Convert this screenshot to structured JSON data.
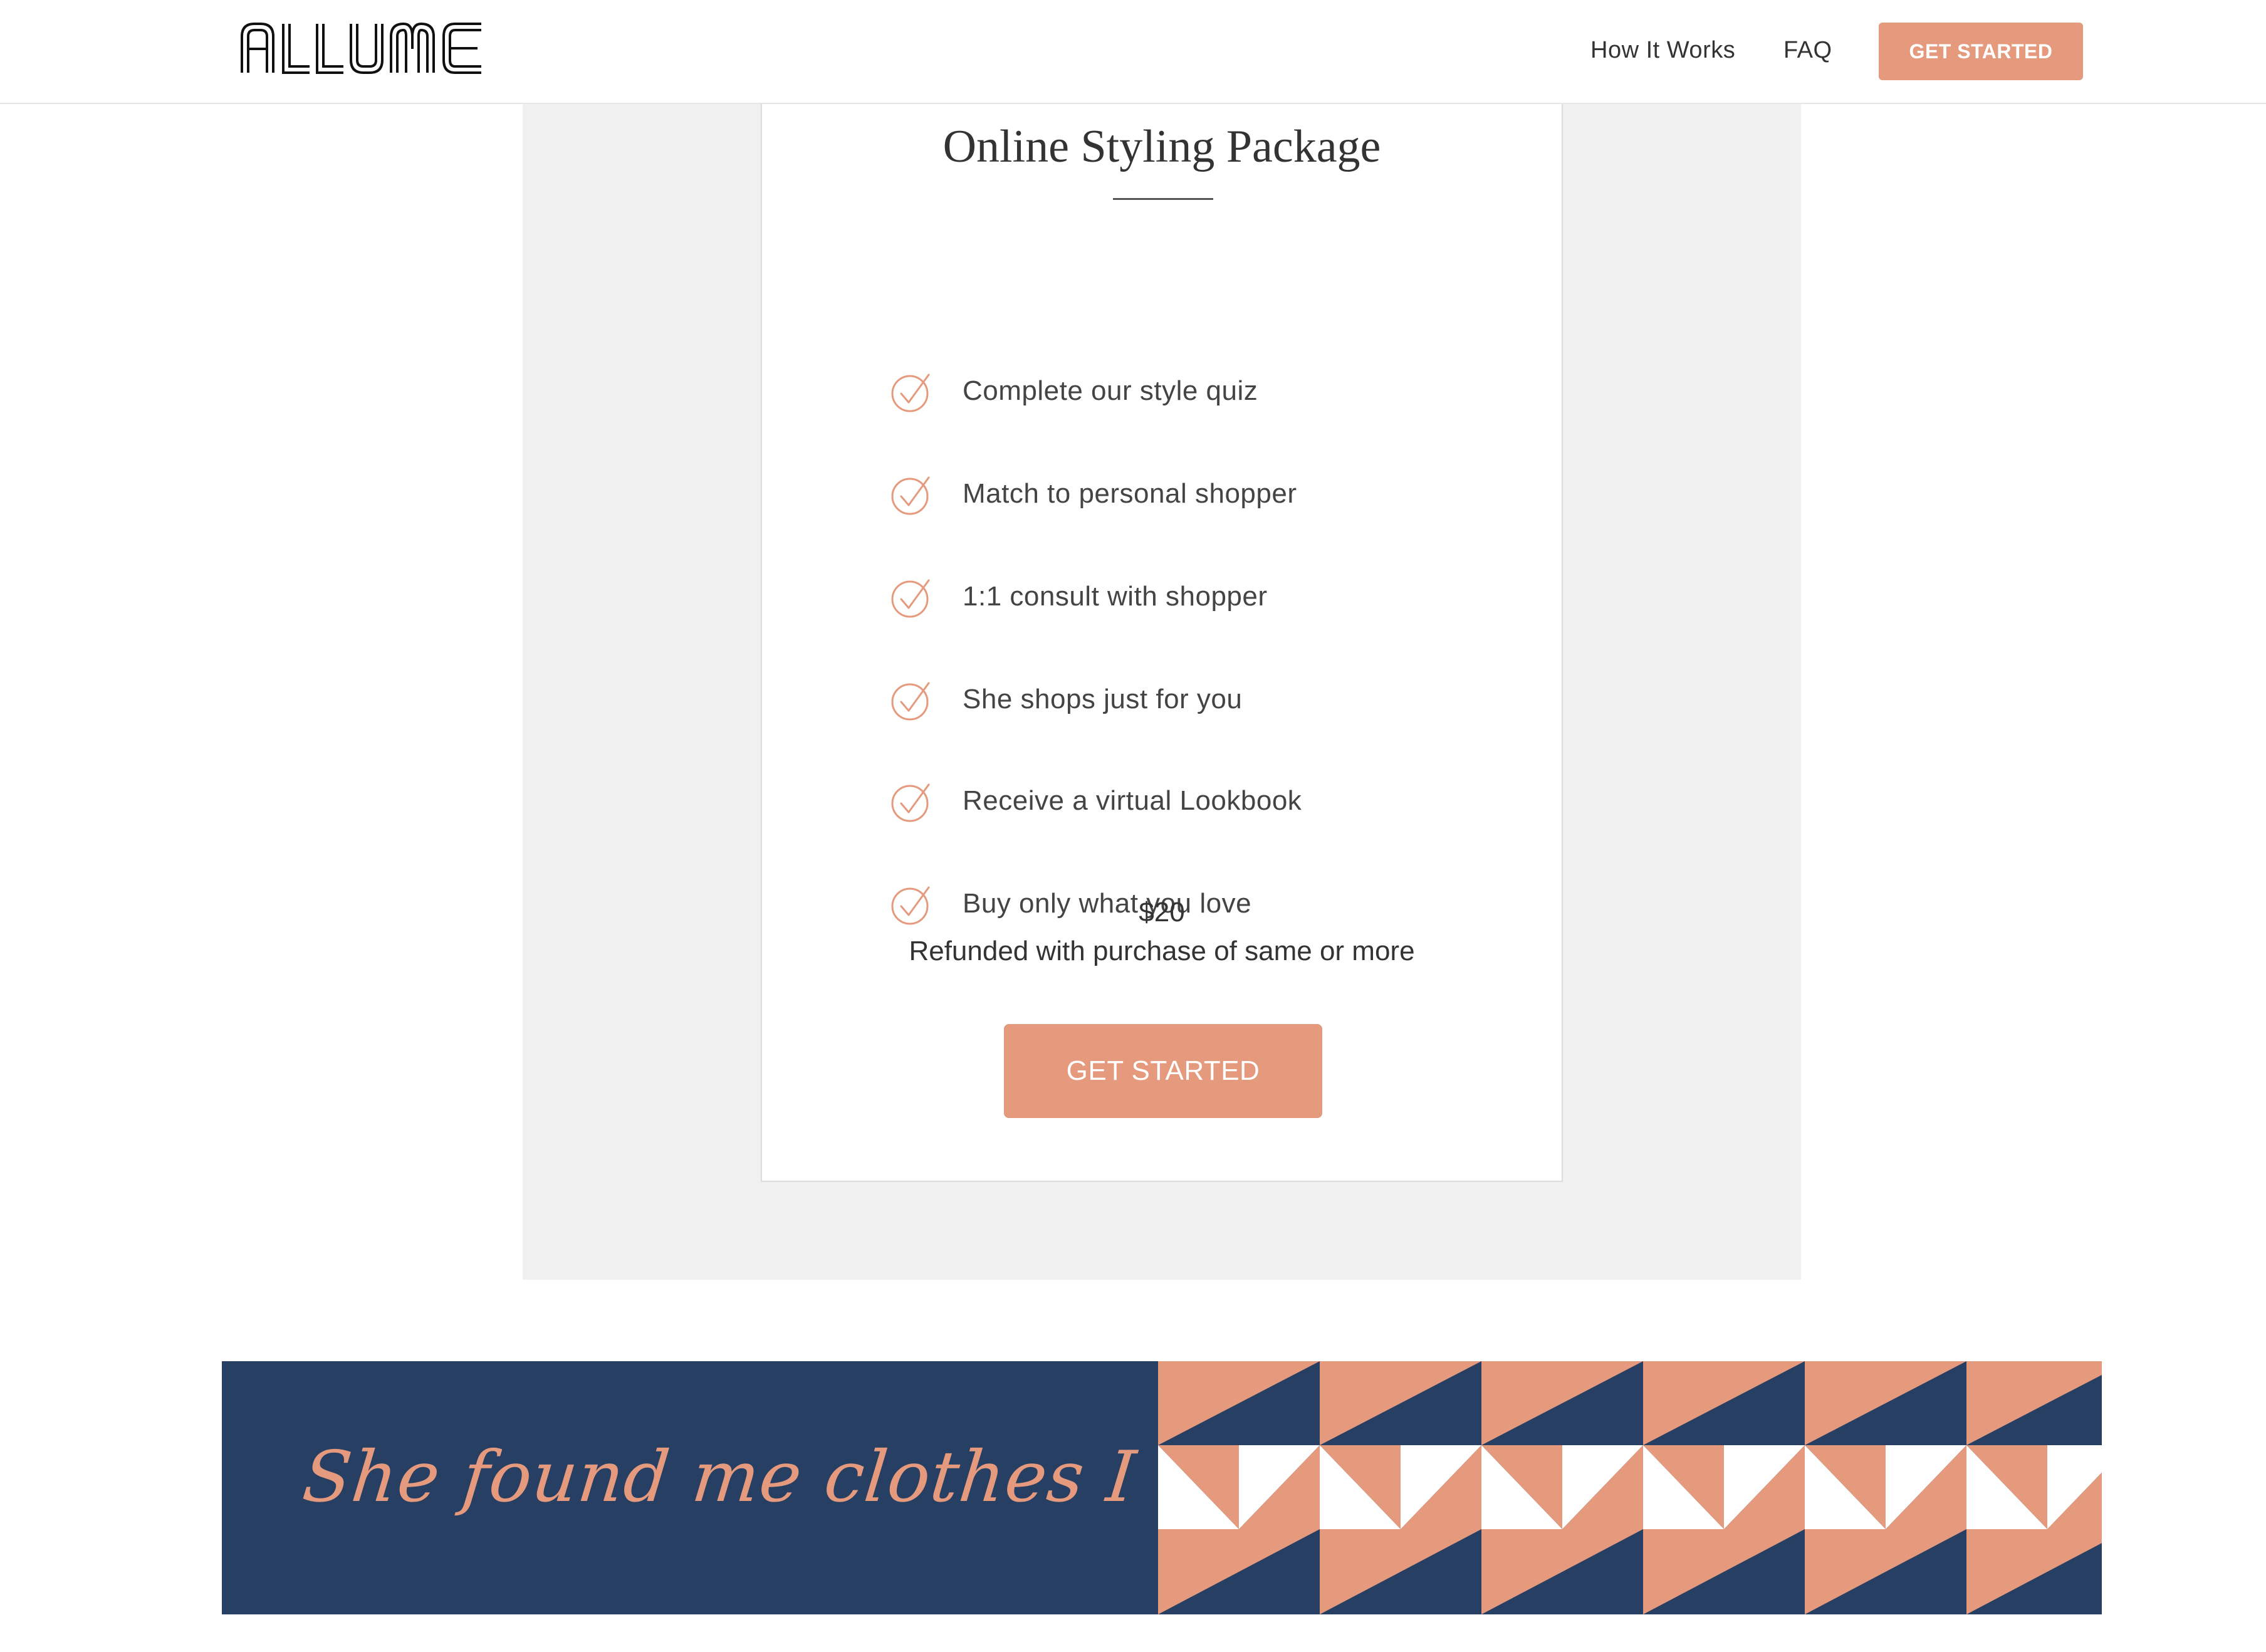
{
  "header": {
    "logo_text": "ALLUME",
    "nav": {
      "how_it_works": "How It Works",
      "faq": "FAQ"
    },
    "cta_label": "GET STARTED"
  },
  "package": {
    "title": "Online Styling Package",
    "features": [
      "Complete our style quiz",
      "Match to personal shopper",
      "1:1 consult with shopper",
      "She shops just for you",
      "Receive a virtual Lookbook",
      "Buy only what you love"
    ],
    "price": "$20",
    "refund_note": "Refunded with purchase of same or more",
    "cta_label": "GET STARTED"
  },
  "banner": {
    "quote": "She found me clothes I love."
  },
  "colors": {
    "accent": "#e5997d",
    "navy": "#283f64",
    "panel_gray": "#f0f0f0",
    "text": "#333333"
  },
  "icons": {
    "feature_bullet": "check-circle-icon"
  }
}
